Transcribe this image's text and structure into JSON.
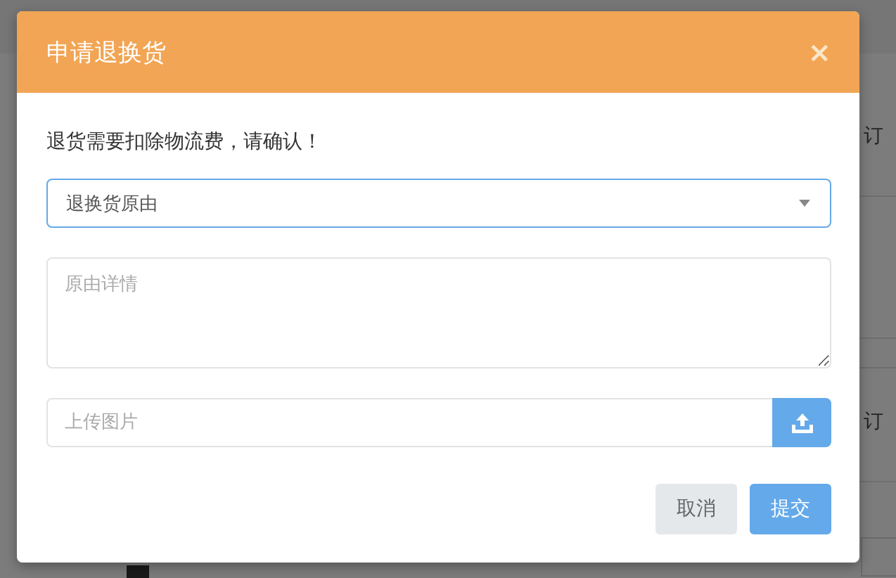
{
  "background": {
    "order_labels": [
      "订",
      "订"
    ]
  },
  "dialog": {
    "title": "申请退换货",
    "close": "×",
    "notice": "退货需要扣除物流费，请确认！",
    "reason": {
      "placeholder": "退换货原由",
      "focused": true
    },
    "details": {
      "placeholder": "原由详情"
    },
    "upload": {
      "placeholder": "上传图片"
    },
    "buttons": [
      {
        "label": "取消",
        "kind": "secondary"
      },
      {
        "label": "提交",
        "kind": "primary"
      }
    ]
  }
}
